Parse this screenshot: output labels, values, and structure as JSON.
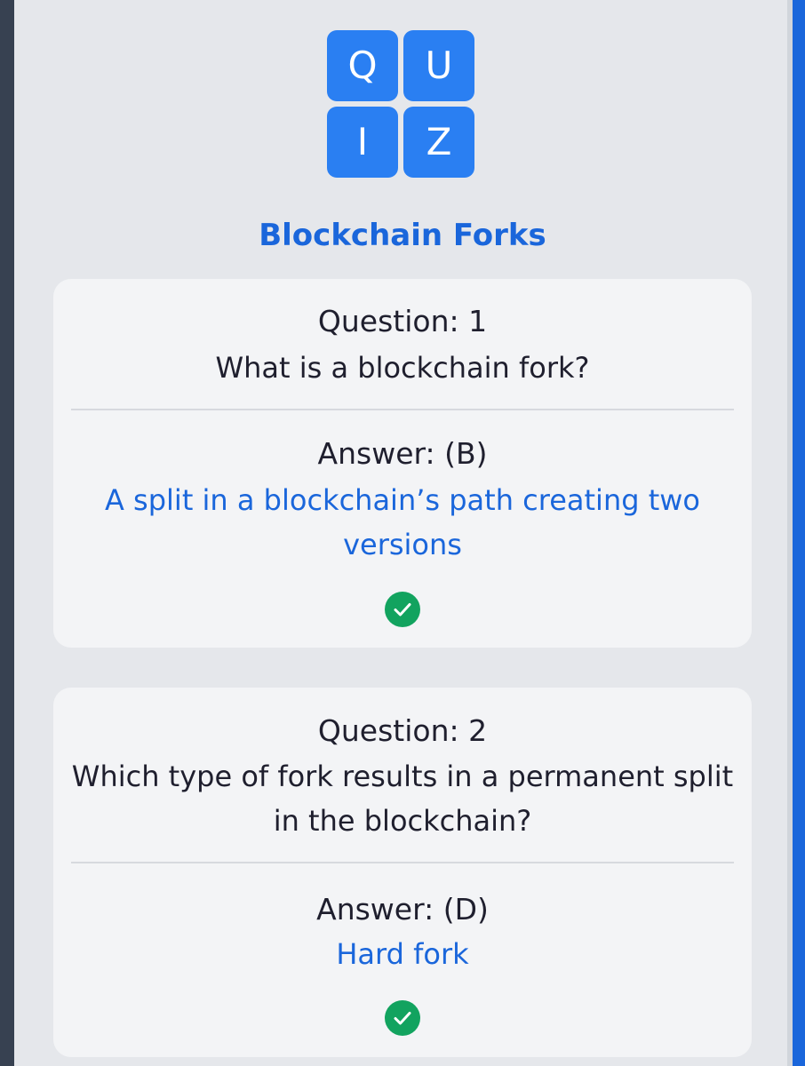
{
  "logo": {
    "letters": [
      "Q",
      "U",
      "I",
      "Z"
    ],
    "tile_color": "#2a7ff2"
  },
  "quiz": {
    "title": "Blockchain Forks"
  },
  "questions": [
    {
      "heading": "Question: 1",
      "text": "What is a blockchain fork?",
      "answer_heading": "Answer: (B)",
      "answer_text": "A split in a blockchain’s path creating two versions",
      "status_icon": "check-circle-icon"
    },
    {
      "heading": "Question: 2",
      "text": "Which type of fork results in a permanent split in the blockchain?",
      "answer_heading": "Answer: (D)",
      "answer_text": "Hard fork",
      "status_icon": "check-circle-icon"
    }
  ],
  "colors": {
    "accent": "#1a66db",
    "correct": "#12a35f",
    "background": "#e5e7eb",
    "card": "#f3f4f6"
  }
}
